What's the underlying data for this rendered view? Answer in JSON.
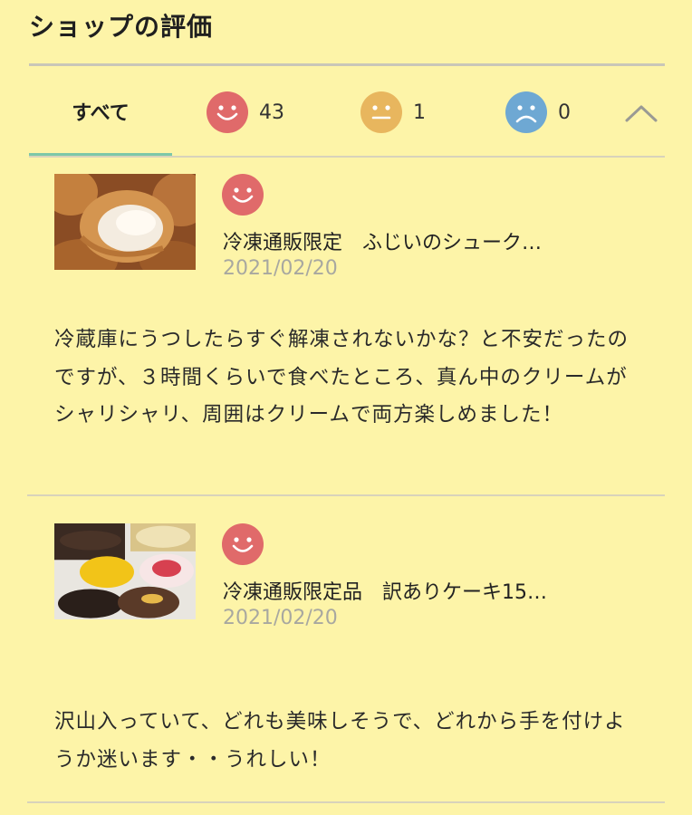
{
  "header": {
    "title": "ショップの評価"
  },
  "tabs": {
    "all_label": "すべて",
    "good_count": "43",
    "neutral_count": "1",
    "bad_count": "0"
  },
  "colors": {
    "background": "#fdf4a8",
    "good": "#e06a6a",
    "neutral": "#e8b65e",
    "bad": "#6ea8d3",
    "accent_underline": "#7dc7a8"
  },
  "reviews": [
    {
      "rating": "good",
      "product": "冷凍通販限定　ふじいのシューク…",
      "date": "2021/02/20",
      "body": "冷蔵庫にうつしたらすぐ解凍されないかな？と不安だったのですが、３時間くらいで食べたところ、真ん中のクリームがシャリシャリ、周囲はクリームで両方楽しめました！"
    },
    {
      "rating": "good",
      "product": "冷凍通販限定品　訳ありケーキ15…",
      "date": "2021/02/20",
      "body": "沢山入っていて、どれも美味しそうで、どれから手を付けようか迷います・・うれしい！"
    }
  ]
}
